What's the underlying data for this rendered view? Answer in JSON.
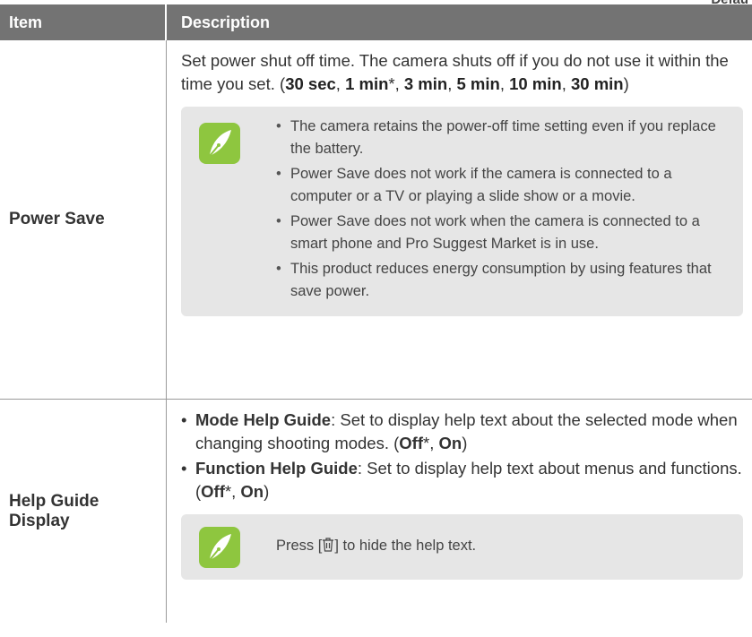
{
  "corner_text": "Defau",
  "header": {
    "item": "Item",
    "description": "Description"
  },
  "rows": [
    {
      "item": "Power Save",
      "desc_text": "Set power shut off time. The camera shuts off if you do not use it within the time you set. (",
      "options": [
        "30 sec",
        "1 min",
        "3 min",
        "5 min",
        "10 min",
        "30 min"
      ],
      "default_mark": "*",
      "notes": [
        "The camera retains the power-off time setting even if you replace the battery.",
        "Power Save does not work if the camera is connected to a computer or a TV or playing a slide show or a movie.",
        "Power Save does not work when the camera is connected to a smart phone and Pro Suggest Market is in use.",
        "This product reduces energy consumption by using features that save power."
      ]
    },
    {
      "item": "Help Guide Display",
      "bullets": [
        {
          "title": "Mode Help Guide",
          "text": ": Set to display help text about the selected mode when changing shooting modes. (",
          "opt1": "Off",
          "opt2": "On"
        },
        {
          "title": "Function Help Guide",
          "text": ": Set to display help text about menus and functions. (",
          "opt1": "Off",
          "opt2": "On"
        }
      ],
      "note_pre": "Press [",
      "note_icon": "trash-icon",
      "note_post": "] to hide the help text."
    }
  ],
  "colors": {
    "header_bg": "#737373",
    "note_bg": "#e6e6e6",
    "note_icon_bg": "#8ec63f"
  }
}
